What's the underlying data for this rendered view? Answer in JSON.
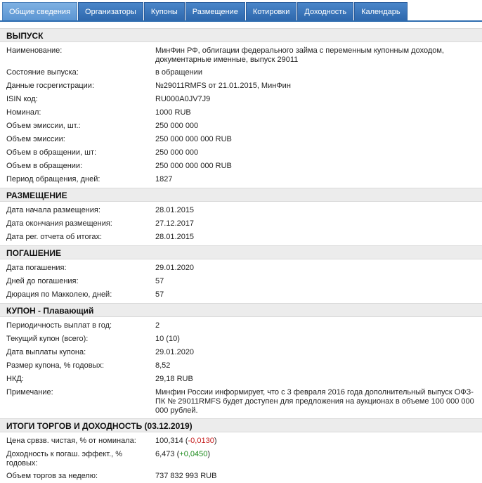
{
  "tabs": [
    {
      "label": "Общие сведения",
      "active": true
    },
    {
      "label": "Организаторы"
    },
    {
      "label": "Купоны"
    },
    {
      "label": "Размещение"
    },
    {
      "label": "Котировки"
    },
    {
      "label": "Доходность"
    },
    {
      "label": "Календарь"
    }
  ],
  "issue": {
    "heading": "ВЫПУСК",
    "rows": [
      {
        "label": "Наименование:",
        "value": "МинФин РФ, облигации федерального займа с переменным купонным доходом, документарные именные, выпуск 29011"
      },
      {
        "label": "Состояние выпуска:",
        "value": "в обращении"
      },
      {
        "label": "Данные госрегистрации:",
        "value": "№29011RMFS от 21.01.2015, МинФин"
      },
      {
        "label": "ISIN код:",
        "value": "RU000A0JV7J9"
      },
      {
        "label": "Номинал:",
        "value": "1000 RUB"
      },
      {
        "label": "Объем эмиссии, шт.:",
        "value": "250 000 000"
      },
      {
        "label": "Объем эмиссии:",
        "value": "250 000 000 000 RUB"
      },
      {
        "label": "Объем в обращении, шт:",
        "value": "250 000 000"
      },
      {
        "label": "Объем в обращении:",
        "value": "250 000 000 000 RUB"
      },
      {
        "label": "Период обращения, дней:",
        "value": "1827"
      }
    ]
  },
  "placement": {
    "heading": "РАЗМЕЩЕНИЕ",
    "rows": [
      {
        "label": "Дата начала размещения:",
        "value": "28.01.2015"
      },
      {
        "label": "Дата окончания размещения:",
        "value": "27.12.2017"
      },
      {
        "label": "Дата рег. отчета об итогах:",
        "value": "28.01.2015"
      }
    ]
  },
  "redemption": {
    "heading": "ПОГАШЕНИЕ",
    "rows": [
      {
        "label": "Дата погашения:",
        "value": "29.01.2020"
      },
      {
        "label": "Дней до погашения:",
        "value": "57"
      },
      {
        "label": "Дюрация по Макколею, дней:",
        "value": "57"
      }
    ]
  },
  "coupon": {
    "heading": "КУПОН - Плавающий",
    "rows": [
      {
        "label": "Периодичность выплат в год:",
        "value": "2"
      },
      {
        "label": "Текущий купон (всего):",
        "value": "10 (10)"
      },
      {
        "label": "Дата выплаты купона:",
        "value": "29.01.2020"
      },
      {
        "label": "Размер купона, % годовых:",
        "value": "8,52"
      },
      {
        "label": "НКД:",
        "value": "29,18 RUB"
      },
      {
        "label": "Примечание:",
        "value": "Минфин России информирует, что с 3 февраля 2016 года дополнительный выпуск ОФЗ-ПК № 29011RMFS будет доступен для предложения на аукционах в объеме 100 000 000 000 рублей."
      }
    ]
  },
  "trading": {
    "heading": "ИТОГИ ТОРГОВ И ДОХОДНОСТЬ (03.12.2019)",
    "price_label": "Цена срвзв. чистая, % от номинала:",
    "price_value": "100,314",
    "price_change": "-0,0130",
    "yield_label": "Доходность к погаш. эффект., % годовых:",
    "yield_value": "6,473",
    "yield_change": "+0,0450",
    "volume_label": "Объем торгов за неделю:",
    "volume_value": "737 832 993 RUB",
    "colors": {
      "positive": "#1a8a1a",
      "negative": "#c41a1a"
    }
  },
  "colors": {
    "tab_bg": "#2e68ad",
    "tab_active_bg": "#5b95d2",
    "section_bg": "#ececec"
  }
}
